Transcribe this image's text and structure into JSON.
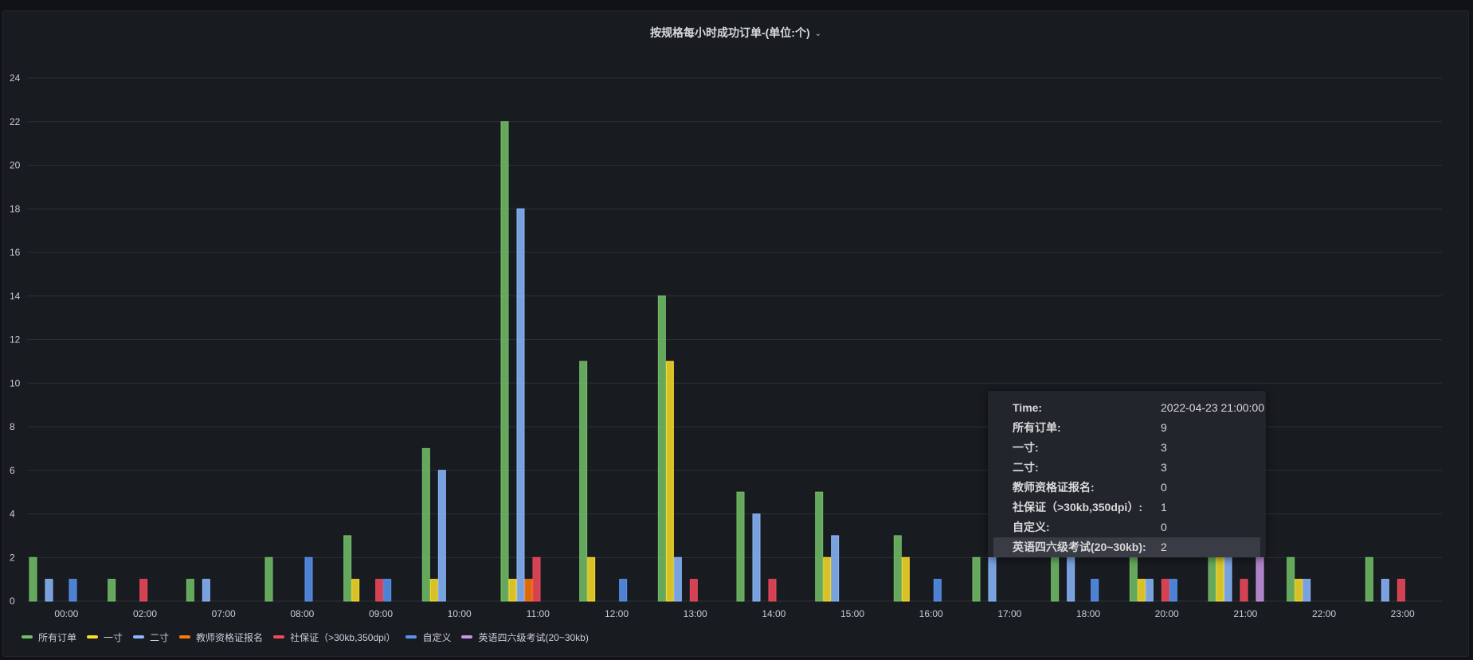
{
  "panel": {
    "title": "按规格每小时成功订单-(单位:个)",
    "title_chevron": "⌄"
  },
  "chart_data": {
    "type": "bar",
    "title": "按规格每小时成功订单-(单位:个)",
    "ylim": [
      0,
      24
    ],
    "yticks": [
      0,
      2,
      4,
      6,
      8,
      10,
      12,
      14,
      16,
      18,
      20,
      22,
      24
    ],
    "grid": true,
    "legend_position": "bottom-left",
    "categories": [
      "00:00",
      "02:00",
      "07:00",
      "08:00",
      "09:00",
      "10:00",
      "11:00",
      "12:00",
      "13:00",
      "14:00",
      "15:00",
      "16:00",
      "17:00",
      "18:00",
      "20:00",
      "21:00",
      "22:00",
      "23:00"
    ],
    "series": [
      {
        "name": "所有订单",
        "color": "#73bf69",
        "values": [
          2,
          1,
          1,
          2,
          3,
          7,
          22,
          11,
          14,
          5,
          5,
          3,
          2,
          2,
          2,
          9,
          2,
          2
        ]
      },
      {
        "name": "一寸",
        "color": "#fade2a",
        "values": [
          0,
          0,
          0,
          0,
          1,
          1,
          1,
          2,
          11,
          0,
          2,
          2,
          0,
          0,
          1,
          3,
          1,
          0
        ]
      },
      {
        "name": "二寸",
        "color": "#8ab8ff",
        "values": [
          1,
          0,
          1,
          0,
          0,
          6,
          18,
          0,
          2,
          4,
          3,
          0,
          2,
          2,
          1,
          3,
          1,
          1
        ]
      },
      {
        "name": "教师资格证报名",
        "color": "#ff780a",
        "values": [
          0,
          0,
          0,
          0,
          0,
          0,
          1,
          0,
          0,
          0,
          0,
          0,
          0,
          0,
          0,
          0,
          0,
          0
        ]
      },
      {
        "name": "社保证（>30kb,350dpi）",
        "color": "#f2495c",
        "values": [
          0,
          1,
          0,
          0,
          1,
          0,
          2,
          0,
          1,
          1,
          0,
          0,
          0,
          0,
          1,
          1,
          0,
          1
        ]
      },
      {
        "name": "自定义",
        "color": "#5794f2",
        "values": [
          1,
          0,
          0,
          2,
          1,
          0,
          0,
          1,
          0,
          0,
          0,
          1,
          0,
          1,
          1,
          0,
          0,
          0
        ]
      },
      {
        "name": "英语四六级考试(20~30kb)",
        "color": "#ca95e5",
        "values": [
          0,
          0,
          0,
          0,
          0,
          0,
          0,
          0,
          0,
          0,
          0,
          0,
          0,
          0,
          0,
          2,
          0,
          0
        ]
      }
    ]
  },
  "tooltip": {
    "rows": [
      {
        "label": "Time:",
        "value": "2022-04-23 21:00:00",
        "highlight": false
      },
      {
        "label": "所有订单:",
        "value": "9",
        "highlight": false
      },
      {
        "label": "一寸:",
        "value": "3",
        "highlight": false
      },
      {
        "label": "二寸:",
        "value": "3",
        "highlight": false
      },
      {
        "label": "教师资格证报名:",
        "value": "0",
        "highlight": false
      },
      {
        "label": "社保证（>30kb,350dpi）:",
        "value": "1",
        "highlight": false
      },
      {
        "label": "自定义:",
        "value": "0",
        "highlight": false
      },
      {
        "label": "英语四六级考试(20~30kb):",
        "value": "2",
        "highlight": true
      }
    ]
  },
  "legend": {
    "items": [
      {
        "label": "所有订单",
        "color": "#73bf69"
      },
      {
        "label": "一寸",
        "color": "#fade2a"
      },
      {
        "label": "二寸",
        "color": "#8ab8ff"
      },
      {
        "label": "教师资格证报名",
        "color": "#ff780a"
      },
      {
        "label": "社保证（>30kb,350dpi）",
        "color": "#f2495c"
      },
      {
        "label": "自定义",
        "color": "#5794f2"
      },
      {
        "label": "英语四六级考试(20~30kb)",
        "color": "#ca95e5"
      }
    ]
  }
}
